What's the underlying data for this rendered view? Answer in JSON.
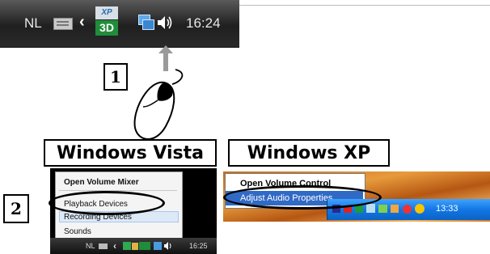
{
  "top_taskbar": {
    "language": "NL",
    "clock": "16:24",
    "icons": [
      "keyboard-icon",
      "show-hidden-icons-chevron",
      "xpert-3d-icon",
      "network-icon",
      "speaker-icon"
    ],
    "xpert_label_line1": "XP",
    "xpert_label_line2": "3D"
  },
  "steps": {
    "step1": "1",
    "step2": "2"
  },
  "headings": {
    "vista": "Windows Vista",
    "xp": "Windows XP"
  },
  "vista": {
    "menu": {
      "title": "Open Volume Mixer",
      "items": [
        "Playback Devices",
        "Recording Devices",
        "Sounds"
      ]
    },
    "taskbar": {
      "language": "NL",
      "clock": "16:25"
    }
  },
  "xp": {
    "menu": {
      "title": "Open Volume Control",
      "items": [
        "Adjust Audio Properties"
      ]
    },
    "tray": {
      "clock": "13:33"
    }
  },
  "colors": {
    "xp_highlight": "#316ac5",
    "xp_taskbar": "#1377e6",
    "vista_bar": "#101010"
  }
}
